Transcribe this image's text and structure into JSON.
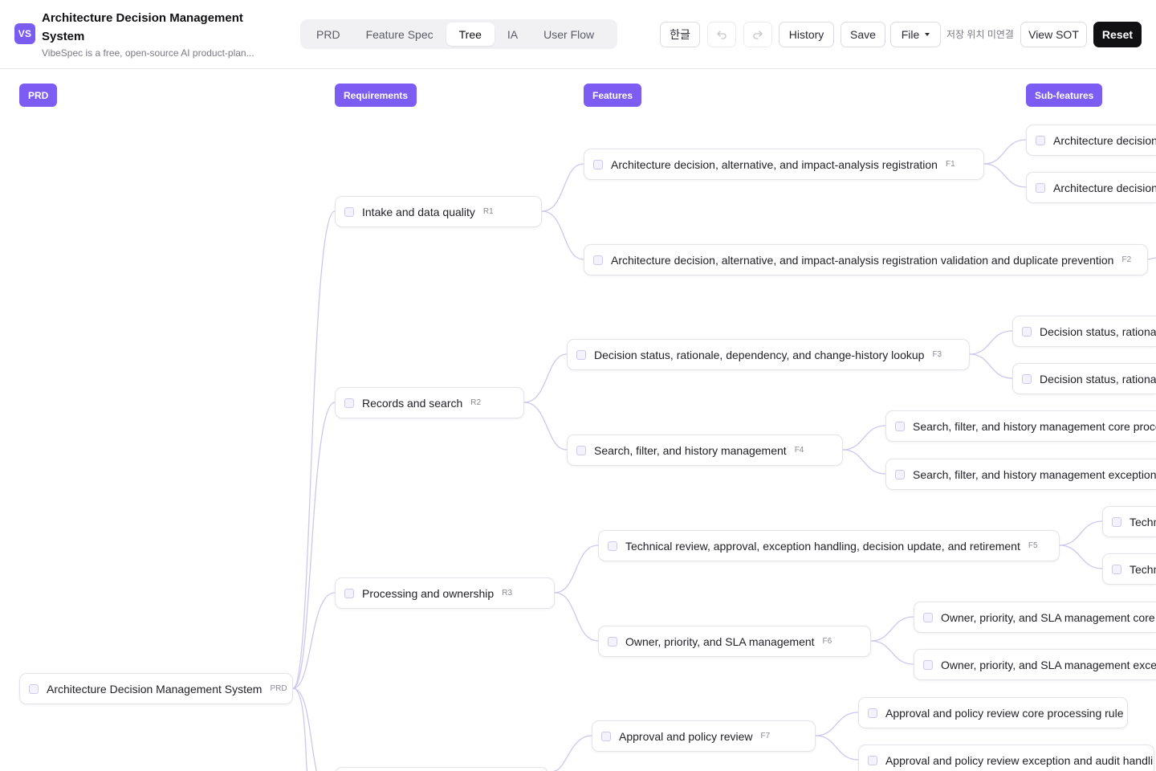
{
  "app": {
    "logo": "VS",
    "title": "Architecture Decision Management System",
    "subtitle": "VibeSpec is a free, open-source AI product-plan..."
  },
  "tabs": [
    {
      "label": "PRD",
      "active": false
    },
    {
      "label": "Feature Spec",
      "active": false
    },
    {
      "label": "Tree",
      "active": true
    },
    {
      "label": "IA",
      "active": false
    },
    {
      "label": "User Flow",
      "active": false
    }
  ],
  "toolbar": {
    "lang_label": "한글",
    "undo_icon": "undo-icon",
    "redo_icon": "redo-icon",
    "history_label": "History",
    "save_label": "Save",
    "file_label": "File",
    "save_status": "저장 위치 미연결",
    "view_sot_label": "View SOT",
    "reset_label": "Reset"
  },
  "colors": {
    "accent": "#7c5cf2",
    "link": "#cfc6ee",
    "dark": "#111114"
  },
  "columns": {
    "prd": "PRD",
    "requirements": "Requirements",
    "features": "Features",
    "subfeatures": "Sub-features"
  },
  "tree": {
    "root": {
      "label": "Architecture Decision Management System",
      "code": "PRD"
    },
    "requirements": [
      {
        "label": "Intake and data quality",
        "code": "R1"
      },
      {
        "label": "Records and search",
        "code": "R2"
      },
      {
        "label": "Processing and ownership",
        "code": "R3"
      }
    ],
    "features": [
      {
        "label": "Architecture decision, alternative, and impact-analysis registration",
        "code": "F1"
      },
      {
        "label": "Architecture decision, alternative, and impact-analysis registration validation and duplicate prevention",
        "code": "F2"
      },
      {
        "label": "Decision status, rationale, dependency, and change-history lookup",
        "code": "F3"
      },
      {
        "label": "Search, filter, and history management",
        "code": "F4"
      },
      {
        "label": "Technical review, approval, exception handling, decision update, and retirement",
        "code": "F5"
      },
      {
        "label": "Owner, priority, and SLA management",
        "code": "F6"
      },
      {
        "label": "Approval and policy review",
        "code": "F7"
      }
    ],
    "subfeatures": [
      {
        "label": "Architecture decision, a"
      },
      {
        "label": "Architecture decision, a"
      },
      {
        "label": "Decision status, rationale,"
      },
      {
        "label": "Decision status, rationale,"
      },
      {
        "label": "Search, filter, and history management core processin"
      },
      {
        "label": "Search, filter, and history management exception and"
      },
      {
        "label": "Techn"
      },
      {
        "label": "Techn"
      },
      {
        "label": "Owner, priority, and SLA management core proc"
      },
      {
        "label": "Owner, priority, and SLA management exceptio"
      },
      {
        "label": "Approval and policy review core processing rule"
      },
      {
        "label": "Approval and policy review exception and audit handling"
      }
    ]
  }
}
